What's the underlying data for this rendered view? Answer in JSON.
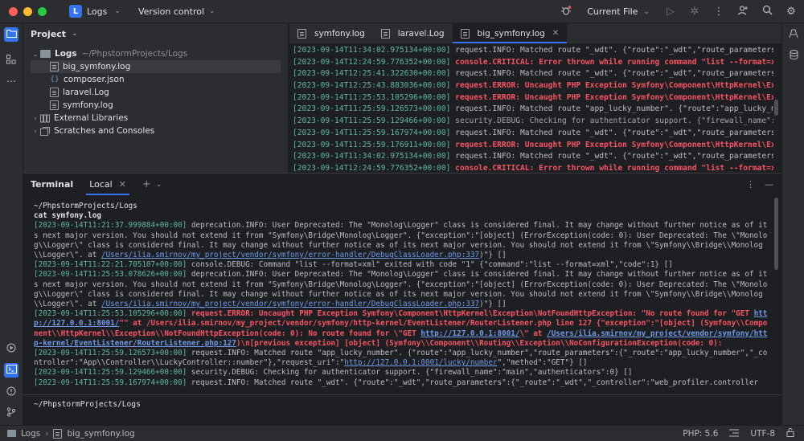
{
  "titlebar": {
    "project_badge": "L",
    "project_name": "Logs",
    "vcs": "Version control",
    "run_config": "Current File"
  },
  "project_panel": {
    "title": "Project",
    "root_name": "Logs",
    "root_path": "~/PhpstormProjects/Logs",
    "files": [
      "big_symfony.log",
      "composer.json",
      "laravel.Log",
      "symfony.log"
    ],
    "external_libraries": "External Libraries",
    "scratches": "Scratches and Consoles"
  },
  "editor": {
    "tabs": [
      "symfony.log",
      "laravel.Log",
      "big_symfony.log"
    ],
    "lines": [
      {
        "date": "[2023-09-14T11:34:02.975134+00:00]",
        "text": " request.INFO: Matched route \"_wdt\". {\"route\":\"_wdt\",\"route_parameters\":{",
        "kind": "info"
      },
      {
        "date": "[2023-09-14T12:24:59.776352+00:00]",
        "text": " console.CRITICAL: Error thrown while running command \"list --format=xml\"",
        "kind": "err"
      },
      {
        "date": "[2023-09-14T12:25:41.322630+00:00]",
        "text": " request.INFO: Matched route \"_wdt\". {\"route\":\"_wdt\",\"route_parameters\":{",
        "kind": "info"
      },
      {
        "date": "[2023-09-14T12:25:43.883036+00:00]",
        "text": " request.ERROR: Uncaught PHP Exception Symfony\\Component\\HttpKernel\\Except",
        "kind": "err"
      },
      {
        "date": "[2023-09-14T11:25:53.105296+00:00]",
        "text": " request.ERROR: Uncaught PHP Exception Symfony\\Component\\HttpKernel\\Except",
        "kind": "err"
      },
      {
        "date": "[2023-09-14T11:25:59.126573+00:00]",
        "text": " request.INFO: Matched route \"app_lucky_number\". {\"route\":\"app_lucky_numb",
        "kind": "info"
      },
      {
        "date": "[2023-09-14T11:25:59.129466+00:00]",
        "text": " security.DEBUG: Checking for authenticator support. {\"firewall_name\":\"mai",
        "kind": "dbg"
      },
      {
        "date": "[2023-09-14T11:25:59.167974+00:00]",
        "text": " request.INFO: Matched route \"_wdt\". {\"route\":\"_wdt\",\"route_parameters\":{",
        "kind": "info"
      },
      {
        "date": "[2023-09-14T11:25:59.176911+00:00]",
        "text": " request.ERROR: Uncaught PHP Exception Symfony\\Component\\HttpKernel\\Except",
        "kind": "err"
      },
      {
        "date": "[2023-09-14T11:34:02.975134+00:00]",
        "text": " request.INFO: Matched route \"_wdt\". {\"route\":\"_wdt\",\"route_parameters\":{",
        "kind": "info"
      },
      {
        "date": "[2023-09-14T12:24:59.776352+00:00]",
        "text": " console.CRITICAL: Error thrown while running command \"list --format=xml\"",
        "kind": "err"
      }
    ]
  },
  "terminal": {
    "title": "Terminal",
    "tab": "Local",
    "cwd": "~/PhpstormProjects/Logs",
    "command": "cat symfony.log",
    "prompt": "~/PhpstormProjects/Logs"
  },
  "statusbar": {
    "crumb_root": "Logs",
    "crumb_file": "big_symfony.log",
    "php": "PHP: 5.6",
    "encoding": "UTF-8"
  }
}
